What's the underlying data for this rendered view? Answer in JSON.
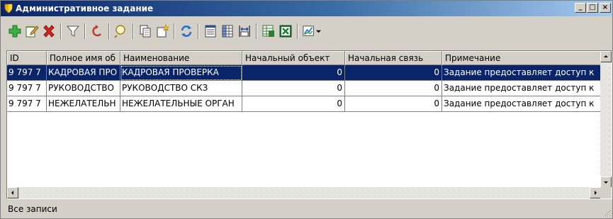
{
  "window": {
    "title": "Административное задание",
    "minimize_label": "_",
    "maximize_label": "□",
    "close_label": "×"
  },
  "toolbar": {
    "buttons": [
      {
        "icon": "add-icon"
      },
      {
        "icon": "edit-icon"
      },
      {
        "icon": "delete-icon"
      },
      {
        "icon": "filter-icon"
      },
      {
        "icon": "undo-icon"
      },
      {
        "icon": "search-icon"
      },
      {
        "icon": "copy-icon"
      },
      {
        "icon": "new-record-icon"
      },
      {
        "icon": "refresh-icon"
      },
      {
        "icon": "list-view-icon"
      },
      {
        "icon": "columns-icon"
      },
      {
        "icon": "fit-width-icon"
      },
      {
        "icon": "export-icon"
      },
      {
        "icon": "excel-icon"
      },
      {
        "icon": "chart-icon"
      }
    ]
  },
  "grid": {
    "columns": [
      "ID",
      "Полное имя об",
      "Наименование",
      "Начальный объект",
      "Начальная связь",
      "Примечание"
    ],
    "rows": [
      {
        "id": "9 797 7",
        "full_name": "КАДРОВАЯ ПРО",
        "name": "КАДРОВАЯ ПРОВЕРКА",
        "start_object": "0",
        "start_link": "0",
        "note": "Задание предоставляет доступ к",
        "selected": true
      },
      {
        "id": "9 797 7",
        "full_name": "РУКОВОДСТВО",
        "name": "РУКОВОДСТВО СКЗ",
        "start_object": "0",
        "start_link": "0",
        "note": "Задание предоставляет доступ к",
        "selected": false
      },
      {
        "id": "9 797 7",
        "full_name": "НЕЖЕЛАТЕЛЬН",
        "name": "НЕЖЕЛАТЕЛЬНЫЕ ОРГАН",
        "start_object": "0",
        "start_link": "0",
        "note": "Задание предоставляет доступ к",
        "selected": false
      }
    ]
  },
  "status": {
    "text": "Все записи"
  },
  "colors": {
    "selection": "#0a246a",
    "title_start": "#0a246a",
    "title_end": "#a6caf0",
    "face": "#d4d0c8"
  }
}
